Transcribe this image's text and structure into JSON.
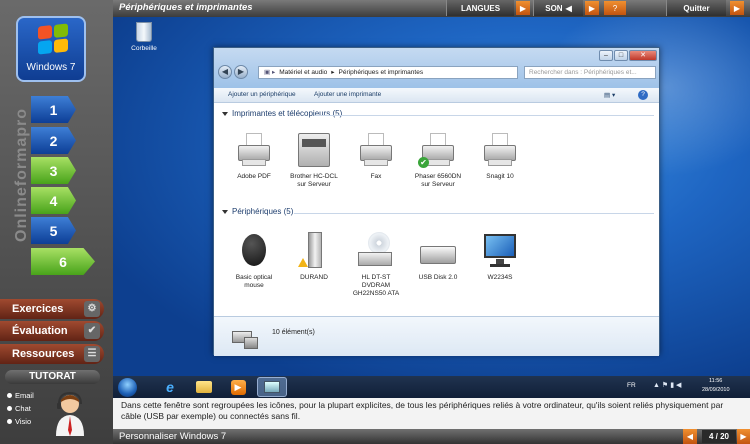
{
  "app": {
    "logo_text": "Windows 7",
    "brand_vertical": "Onlineformapro",
    "page_title": "Périphériques et imprimantes",
    "course_title": "Personnaliser Windows 7"
  },
  "top_buttons": {
    "langues": "LANGUES",
    "son": "SON",
    "help": "?",
    "quit": "Quitter"
  },
  "steps": [
    "1",
    "2",
    "3",
    "4",
    "5",
    "6"
  ],
  "side_buttons": {
    "exercices": "Exercices",
    "evaluation": "Évaluation",
    "ressources": "Ressources"
  },
  "tutorat": {
    "title": "TUTORAT",
    "options": [
      "Email",
      "Chat",
      "Visio"
    ]
  },
  "desktop": {
    "recycle_label": "Corbeille"
  },
  "explorer": {
    "breadcrumb": [
      "Matériel et audio",
      "Périphériques et imprimantes"
    ],
    "search_placeholder": "Rechercher dans : Périphériques et...",
    "commands": {
      "add_device": "Ajouter un périphérique",
      "add_printer": "Ajouter une imprimante"
    },
    "section_printers": "Imprimantes et télécopieurs (5)",
    "printers": [
      {
        "label": "Adobe PDF"
      },
      {
        "label": "Brother HC-DCL sur Serveur"
      },
      {
        "label": "Fax"
      },
      {
        "label": "Phaser 6560DN sur Serveur"
      },
      {
        "label": "Snagit 10"
      }
    ],
    "section_devices": "Périphériques (5)",
    "devices": [
      {
        "label": "Basic optical mouse"
      },
      {
        "label": "DURAND"
      },
      {
        "label": "HL DT-ST DVDRAM GH22NS50 ATA"
      },
      {
        "label": "USB Disk 2.0"
      },
      {
        "label": "W2234S"
      }
    ],
    "status_count": "10 élément(s)"
  },
  "taskbar": {
    "lang": "FR",
    "time": "11:56",
    "date": "28/09/2010"
  },
  "info_text": "Dans cette fenêtre sont regroupées les icônes, pour la plupart explicites, de tous les périphériques reliés à votre ordinateur, qu'ils soient reliés physiquement par câble (USB par exemple) ou connectés sans fil.",
  "pager": "4 / 20"
}
